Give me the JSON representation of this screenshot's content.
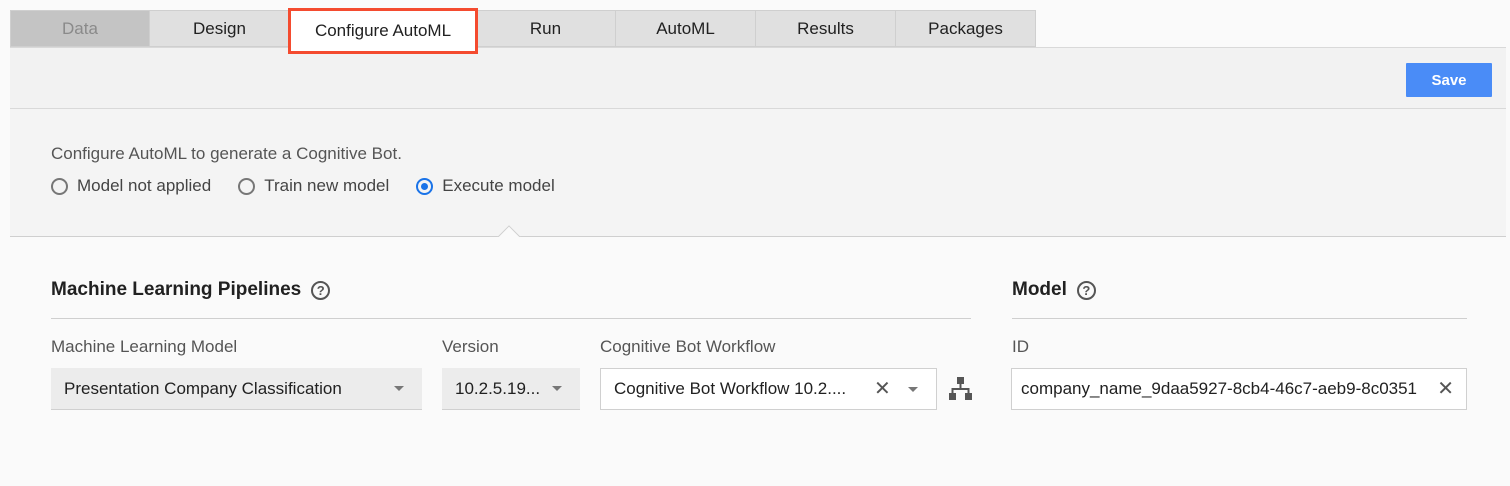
{
  "tabs": [
    {
      "label": "Data",
      "state": "disabled"
    },
    {
      "label": "Design",
      "state": "normal"
    },
    {
      "label": "Configure AutoML",
      "state": "active"
    },
    {
      "label": "Run",
      "state": "normal"
    },
    {
      "label": "AutoML",
      "state": "normal"
    },
    {
      "label": "Results",
      "state": "normal"
    },
    {
      "label": "Packages",
      "state": "normal"
    }
  ],
  "toolbar": {
    "save_label": "Save"
  },
  "config": {
    "description": "Configure AutoML to generate a Cognitive Bot.",
    "options": [
      {
        "label": "Model not applied",
        "selected": false
      },
      {
        "label": "Train new model",
        "selected": false
      },
      {
        "label": "Execute model",
        "selected": true
      }
    ]
  },
  "pipelines": {
    "title": "Machine Learning Pipelines",
    "ml_model_label": "Machine Learning Model",
    "ml_model_value": "Presentation Company Classification",
    "version_label": "Version",
    "version_value": "10.2.5.19...",
    "workflow_label": "Cognitive Bot Workflow",
    "workflow_value": "Cognitive Bot Workflow 10.2...."
  },
  "model": {
    "title": "Model",
    "id_label": "ID",
    "id_value": "company_name_9daa5927-8cb4-46c7-aeb9-8c0351"
  },
  "colors": {
    "accent": "#4a8cf7",
    "highlight": "#f44b2f",
    "radio": "#1a73e8"
  },
  "icons": {
    "help": "help-circle-icon",
    "clear": "close-icon",
    "dropdown": "chevron-down-icon",
    "workflow": "workflow-tree-icon"
  }
}
